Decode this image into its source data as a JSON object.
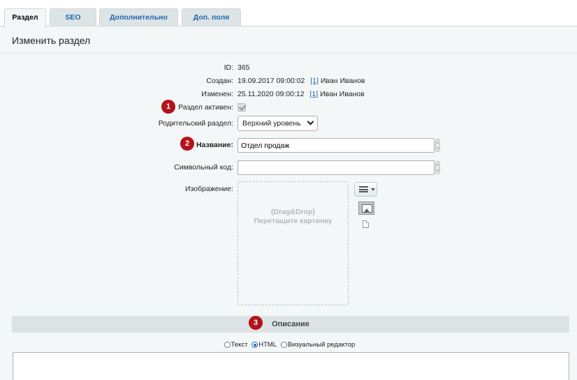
{
  "tabs": [
    {
      "label": "Раздел",
      "active": true
    },
    {
      "label": "SEO",
      "active": false
    },
    {
      "label": "Дополнительно",
      "active": false
    },
    {
      "label": "Доп. поля",
      "active": false
    }
  ],
  "page_title": "Изменить раздел",
  "fields": {
    "id": {
      "label": "ID:",
      "value": "365"
    },
    "created": {
      "label": "Создан:",
      "date": "19.09.2017 09:00:02",
      "user_link": "[1]",
      "user_name": "Иван Иванов"
    },
    "modified": {
      "label": "Изменен:",
      "date": "25.11.2020 09:00:12",
      "user_link": "[1]",
      "user_name": "Иван Иванов"
    },
    "active": {
      "label": "Раздел активен:",
      "checked": true
    },
    "parent": {
      "label": "Родительский раздел:",
      "value": "Верхний уровень"
    },
    "name": {
      "label": "Название:",
      "value": "Отдел продаж"
    },
    "code": {
      "label": "Символьный код:",
      "value": ""
    },
    "image": {
      "label": "Изображение:",
      "drop_line1": "(Drag&Drop)",
      "drop_line2": "Перетащите картинку"
    }
  },
  "badges": [
    "1",
    "2",
    "3"
  ],
  "description": {
    "header": "Описание",
    "modes": [
      {
        "label": "Текст",
        "selected": false
      },
      {
        "label": "HTML",
        "selected": true
      },
      {
        "label": "Визуальный редактор",
        "selected": false
      }
    ]
  },
  "colors": {
    "badge": "#b5121b",
    "link": "#2067b0",
    "panel": "#f4f7f7"
  },
  "icons": [
    "menu-lines-icon",
    "image-icon",
    "file-icon",
    "chevron-down-icon",
    "translit-icon"
  ]
}
